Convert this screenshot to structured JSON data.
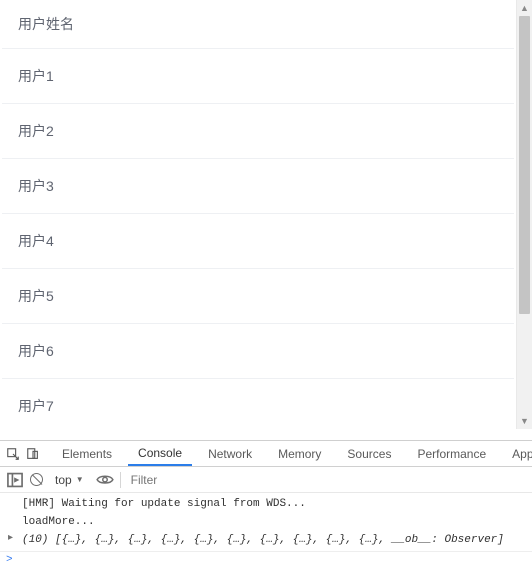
{
  "list": {
    "header": "用户姓名",
    "rows": [
      "用户1",
      "用户2",
      "用户3",
      "用户4",
      "用户5",
      "用户6",
      "用户7"
    ]
  },
  "devtools": {
    "tabs": {
      "elements": "Elements",
      "console": "Console",
      "network": "Network",
      "memory": "Memory",
      "sources": "Sources",
      "performance": "Performance",
      "application": "Applic"
    },
    "toolbar": {
      "context": "top",
      "filter_placeholder": "Filter"
    },
    "console": {
      "line1": "[HMR] Waiting for update signal from WDS...",
      "line2": "loadMore...",
      "line3": "(10) [{…}, {…}, {…}, {…}, {…}, {…}, {…}, {…}, {…}, {…}, __ob__: Observer]"
    },
    "prompt": ">"
  }
}
